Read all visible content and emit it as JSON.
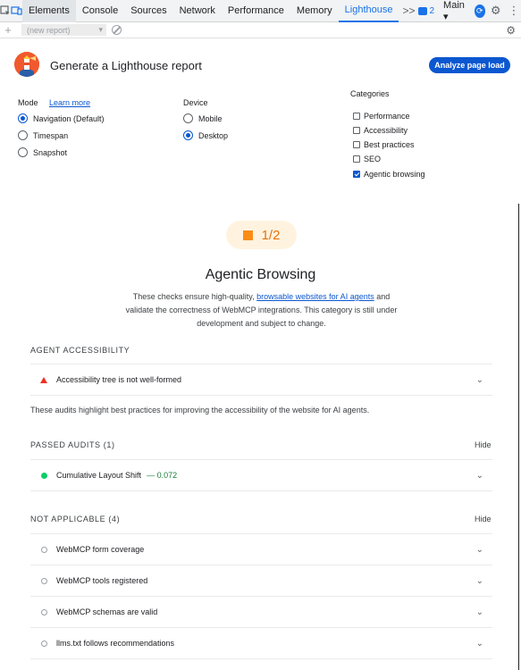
{
  "devtools": {
    "tabs": [
      "Elements",
      "Console",
      "Sources",
      "Network",
      "Performance",
      "Memory",
      "Lighthouse"
    ],
    "overflow": ">>",
    "issues_count": "2",
    "context": "Main ▾",
    "icons": [
      "inspect-icon",
      "device-toggle-icon",
      "issues-icon",
      "performance-panel-icon",
      "settings-icon",
      "more-vert-icon",
      "close-icon"
    ]
  },
  "toolbar": {
    "add": "+",
    "report_placeholder": "(new report)",
    "dropdown": "▾"
  },
  "header": {
    "title": "Generate a Lighthouse report",
    "analyze_label": "Analyze page load"
  },
  "mode": {
    "heading": "Mode",
    "learn_more": "Learn more",
    "options": [
      "Navigation (Default)",
      "Timespan",
      "Snapshot"
    ],
    "selected": "Navigation (Default)"
  },
  "device": {
    "heading": "Device",
    "options": [
      "Mobile",
      "Desktop"
    ],
    "selected": "Desktop"
  },
  "categories": {
    "heading": "Categories",
    "items": [
      {
        "label": "Performance",
        "checked": false
      },
      {
        "label": "Accessibility",
        "checked": false
      },
      {
        "label": "Best practices",
        "checked": false
      },
      {
        "label": "SEO",
        "checked": false
      },
      {
        "label": "Agentic browsing",
        "checked": true
      }
    ]
  },
  "report": {
    "score": "1/2",
    "score_color": "#fa8c16",
    "title": "Agentic Browsing",
    "desc_before": "These checks ensure high-quality, ",
    "desc_link": "browsable websites for AI agents",
    "desc_after": " and validate the correctness of WebMCP integrations. This category is still under development and subject to change.",
    "agent_accessibility": {
      "heading": "AGENT ACCESSIBILITY",
      "audits": [
        {
          "label": "Accessibility tree is not well-formed"
        }
      ],
      "note": "These audits highlight best practices for improving the accessibility of the website for AI agents."
    },
    "passed": {
      "heading": "PASSED AUDITS (1)",
      "hide": "Hide",
      "audits": [
        {
          "label": "Cumulative Layout Shift",
          "value": "— 0.072"
        }
      ]
    },
    "not_applicable": {
      "heading": "NOT APPLICABLE (4)",
      "hide": "Hide",
      "audits": [
        {
          "label": "WebMCP form coverage"
        },
        {
          "label": "WebMCP tools registered"
        },
        {
          "label": "WebMCP schemas are valid"
        },
        {
          "label": "llms.txt follows recommendations"
        }
      ]
    }
  }
}
